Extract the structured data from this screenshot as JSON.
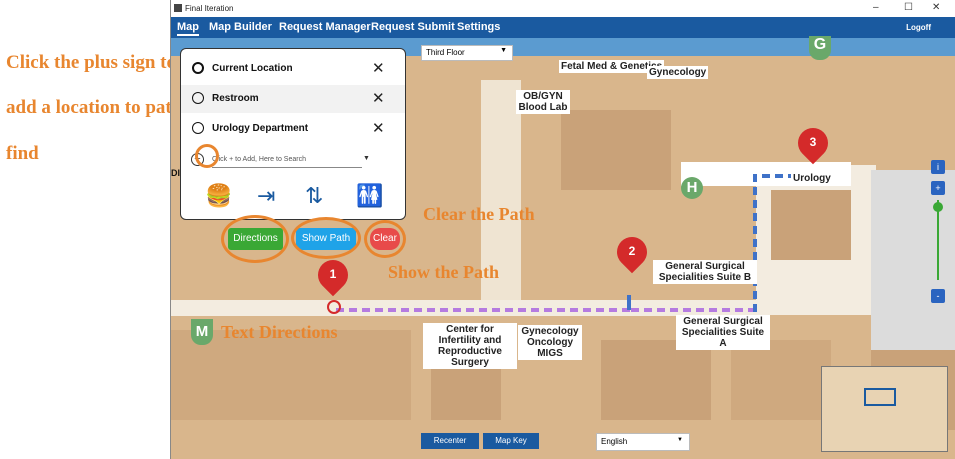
{
  "annotations": {
    "plus_line1": "Click the plus sign to",
    "plus_line2": "add a location to path",
    "plus_line3": "find",
    "clear": "Clear the Path",
    "show": "Show the Path",
    "directions": "Text Directions"
  },
  "window": {
    "title": "Final Iteration",
    "minimize": "–",
    "maximize": "☐",
    "close": "✕"
  },
  "menu": {
    "map": "Map",
    "map_builder": "Map Builder",
    "request_manager": "Request Manager",
    "request_submit": "Request Submit",
    "settings": "Settings",
    "logoff": "Logoff"
  },
  "floor": {
    "value": "Third Floor"
  },
  "panel": {
    "rows": [
      {
        "label": "Current Location",
        "remove": "✕"
      },
      {
        "label": "Restroom",
        "remove": "✕"
      },
      {
        "label": "Urology Department",
        "remove": "✕"
      }
    ],
    "search_placeholder": "Click + to Add, Here to Search",
    "add": "+"
  },
  "buttons": {
    "directions": "Directions",
    "show_path": "Show Path",
    "clear": "Clear"
  },
  "map_labels": {
    "fetal": "Fetal Med & Genetics",
    "gyne": "Gynecology",
    "obgyn": "OB/GYN Blood Lab",
    "urology": "Urology",
    "gssb": "General Surgical Specialities Suite B",
    "gssa": "General Surgical Specialities Suite A",
    "cirs": "Center for Infertility and Reproductive Surgery",
    "gom": "Gynecology Oncology MIGS",
    "letter_g": "G",
    "letter_h": "H",
    "letter_m": "M",
    "di": "DI"
  },
  "pins": [
    "1",
    "2",
    "3"
  ],
  "bottom": {
    "recenter": "Recenter",
    "map_key": "Map Key",
    "language": "English"
  },
  "zoom": {
    "info": "i",
    "in": "+",
    "out": "-"
  },
  "colors": {
    "accent": "#e8862f",
    "menubar": "#1a5aa0",
    "directions": "#3aa835",
    "show_path": "#1fa3e8",
    "clear": "#e84a4a",
    "pin": "#d42a2a",
    "path": "#b57be0"
  }
}
